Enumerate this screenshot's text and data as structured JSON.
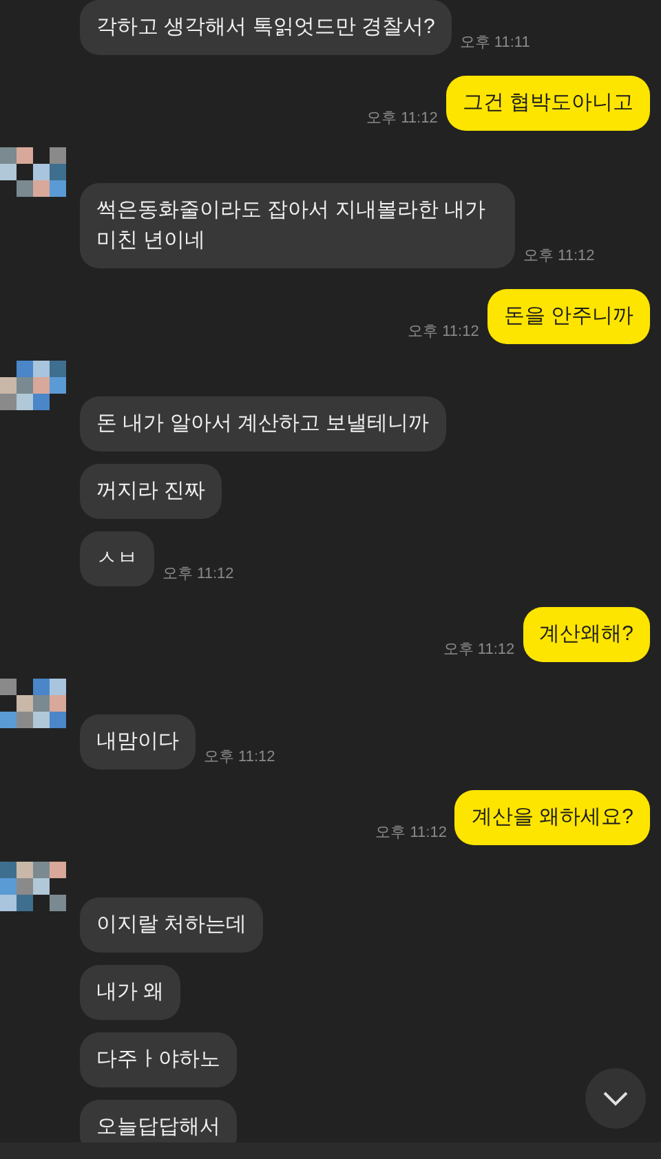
{
  "messages": [
    {
      "kind": "received",
      "avatar": false,
      "text": "각하고 생각해서 톡읽엇드만 경찰서?",
      "time": "오후 11:11"
    },
    {
      "kind": "sent",
      "text": "그건 협박도아니고",
      "time": "오후 11:12"
    },
    {
      "kind": "received",
      "avatar": true,
      "text": "썩은동화줄이라도 잡아서 지내볼라한 내가 미친 년이네",
      "time": "오후 11:12"
    },
    {
      "kind": "sent",
      "text": "돈을 안주니까",
      "time": "오후 11:12"
    },
    {
      "kind": "received",
      "avatar": true,
      "text": "돈 내가 알아서 계산하고 보낼테니까"
    },
    {
      "kind": "received",
      "avatar": false,
      "text": "꺼지라 진짜"
    },
    {
      "kind": "received",
      "avatar": false,
      "text": "ㅅㅂ",
      "time": "오후 11:12"
    },
    {
      "kind": "sent",
      "text": "계산왜해?",
      "time": "오후 11:12"
    },
    {
      "kind": "received",
      "avatar": true,
      "text": "내맘이다",
      "time": "오후 11:12"
    },
    {
      "kind": "sent",
      "text": "계산을 왜하세요?",
      "time": "오후 11:12"
    },
    {
      "kind": "received",
      "avatar": true,
      "text": "이지랄 처하는데"
    },
    {
      "kind": "received",
      "avatar": false,
      "text": "내가 왜"
    },
    {
      "kind": "received",
      "avatar": false,
      "text": "다주ㅏ야하노"
    },
    {
      "kind": "received",
      "avatar": false,
      "text": "오늘답답해서"
    }
  ]
}
